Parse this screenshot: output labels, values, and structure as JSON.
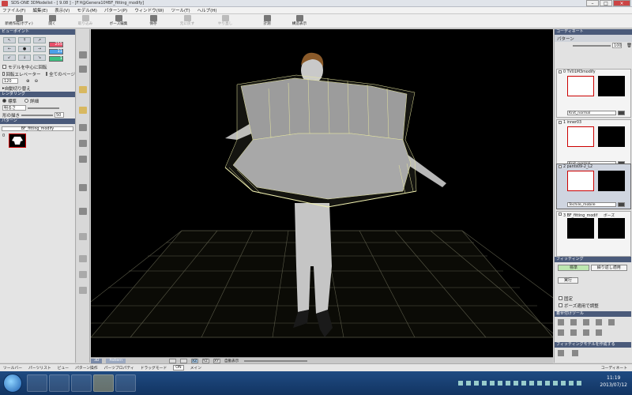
{
  "window": {
    "title": "SDS-ONE 3DModelist - [ 9.08 ] - [F:¥@Genera10¥BF_fitting_modify]",
    "controls": [
      "–",
      "□",
      "×"
    ]
  },
  "menu": [
    "ファイル(F)",
    "編集(E)",
    "表示(V)",
    "モデル(M)",
    "パターン(P)",
    "ウィンドウ(W)",
    "ツール(T)",
    "ヘルプ(H)"
  ],
  "toolbar": [
    {
      "label": "新規作成(ボディ)",
      "enabled": true
    },
    {
      "label": "開く",
      "enabled": true
    },
    {
      "label": "取り込み",
      "enabled": false
    },
    {
      "label": "ボーズ編集",
      "enabled": true
    },
    {
      "label": "保存",
      "enabled": true
    },
    {
      "label": "元に戻す",
      "enabled": false
    },
    {
      "label": "やり直し",
      "enabled": false
    },
    {
      "label": "計測",
      "enabled": true
    },
    {
      "label": "構造表示",
      "enabled": true
    }
  ],
  "left": {
    "view_header": "ビューポイント",
    "colors": [
      "#e8506a",
      "#4aa0e8",
      "#3cc080"
    ],
    "color_values": [
      "255",
      "11",
      "1"
    ],
    "center_rotate": "モデルを中心に回転",
    "rotate_lock": "回転エレベーター",
    "all_pages": "全てのページ",
    "zoom": "120",
    "auto_switch": "自動切り替え",
    "rendering_header": "レンダリング",
    "mode_standard": "標準",
    "mode_detail": "詳細",
    "transparency_label": "明るさ",
    "shape_label": "形の描き",
    "shape_value": "50",
    "pattern_header": "パターン",
    "pattern_item": "BF_fitting_modify",
    "pattern_index": "0"
  },
  "viewport_bar": {
    "tabs": [
      "3D",
      "Pattern"
    ],
    "buttons": [
      "XZ",
      "YZ",
      "XY"
    ],
    "auto_label": "自動表示"
  },
  "right": {
    "header": "コーディネート",
    "pattern_label": "パターン",
    "opacity": "100",
    "cards": [
      {
        "index": "0",
        "title": "TV01M3modify",
        "preset": "Knit_normal",
        "selected": false
      },
      {
        "index": "1",
        "title": "inner03",
        "preset": "Knit_normal",
        "selected": false
      },
      {
        "index": "2",
        "title": "pants09-2_L2",
        "preset": "Techile_mobile",
        "selected": true
      },
      {
        "index": "3",
        "title": "BF_fitting_modif",
        "preset": "ボーズ",
        "selected": false
      }
    ],
    "fitting_header": "フィッティング",
    "fit_standard": "標準",
    "fit_repeat": "繰り返し適用",
    "execute": "実行",
    "opt1": "固定",
    "opt2": "ボーズ適用で調整",
    "tools_header": "着せ付けツール",
    "fitting_model_label": "フィッティングモデルを作成する"
  },
  "status": {
    "items": [
      "ツールバー",
      "パーツリスト",
      "ビュー",
      "パターン操作",
      "パーツプロパティ",
      "ドラッグモード",
      "ON",
      "メイン"
    ],
    "right": "コーディネート"
  },
  "taskbar": {
    "time": "11:19",
    "date": "2013/07/12"
  }
}
